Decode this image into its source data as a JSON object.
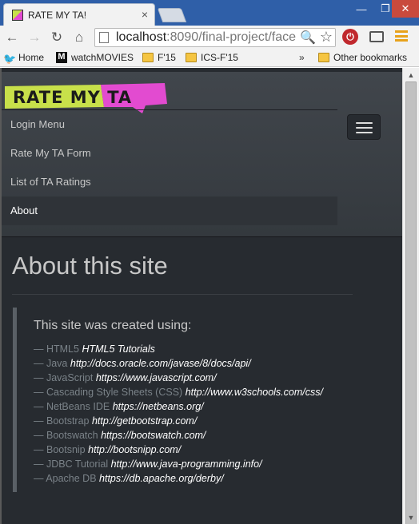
{
  "browser": {
    "tab_title": "RATE MY TA!",
    "tab_close": "×",
    "window_controls": {
      "minimize": "—",
      "maximize": "❐",
      "close": "✕"
    },
    "toolbar": {
      "back": "←",
      "forward": "→",
      "reload": "↻",
      "home": "⌂",
      "url_host": "localhost",
      "url_path": ":8090/final-project/face",
      "search_glyph": "🔍",
      "star_glyph": "☆",
      "ext_glyph": "⏻"
    },
    "bookmarks": {
      "items": [
        {
          "label": "Home",
          "icon": "twitter-bird-icon"
        },
        {
          "label": "watchMOVIES",
          "icon": "m-letter-icon"
        },
        {
          "label": "F'15",
          "icon": "folder-icon"
        },
        {
          "label": "ICS-F'15",
          "icon": "folder-icon"
        }
      ],
      "overflow": "»",
      "other": "Other bookmarks",
      "m_letter": "M"
    }
  },
  "page": {
    "logo_text": "RATE MY TA",
    "logo_colors": {
      "lime": "#c8e04a",
      "magenta": "#e24bd0",
      "ink": "#1b1b1b"
    },
    "nav": [
      {
        "label": "Login Menu",
        "active": false
      },
      {
        "label": "Rate My TA Form",
        "active": false
      },
      {
        "label": "List of TA Ratings",
        "active": false
      },
      {
        "label": "About",
        "active": true
      }
    ],
    "title": "About this site",
    "lead": "This site was created using:",
    "credits": [
      {
        "name": "HTML5",
        "link": "HTML5 Tutorials"
      },
      {
        "name": "Java",
        "link": "http://docs.oracle.com/javase/8/docs/api/"
      },
      {
        "name": "JavaScript",
        "link": "https://www.javascript.com/"
      },
      {
        "name": "Cascading Style Sheets (CSS)",
        "link": "http://www.w3schools.com/css/"
      },
      {
        "name": "NetBeans IDE",
        "link": "https://netbeans.org/"
      },
      {
        "name": "Bootstrap",
        "link": "http://getbootstrap.com/"
      },
      {
        "name": "Bootswatch",
        "link": "https://bootswatch.com/"
      },
      {
        "name": "Bootsnip",
        "link": "http://bootsnipp.com/"
      },
      {
        "name": "JDBC Tutorial",
        "link": "http://www.java-programming.info/"
      },
      {
        "name": "Apache DB",
        "link": "https://db.apache.org/derby/"
      }
    ],
    "dash": "—"
  },
  "colors": {
    "page_background": "#272b30",
    "navbar": "#3a3f44",
    "text": "#c8c8c8",
    "muted": "#7a8288"
  }
}
